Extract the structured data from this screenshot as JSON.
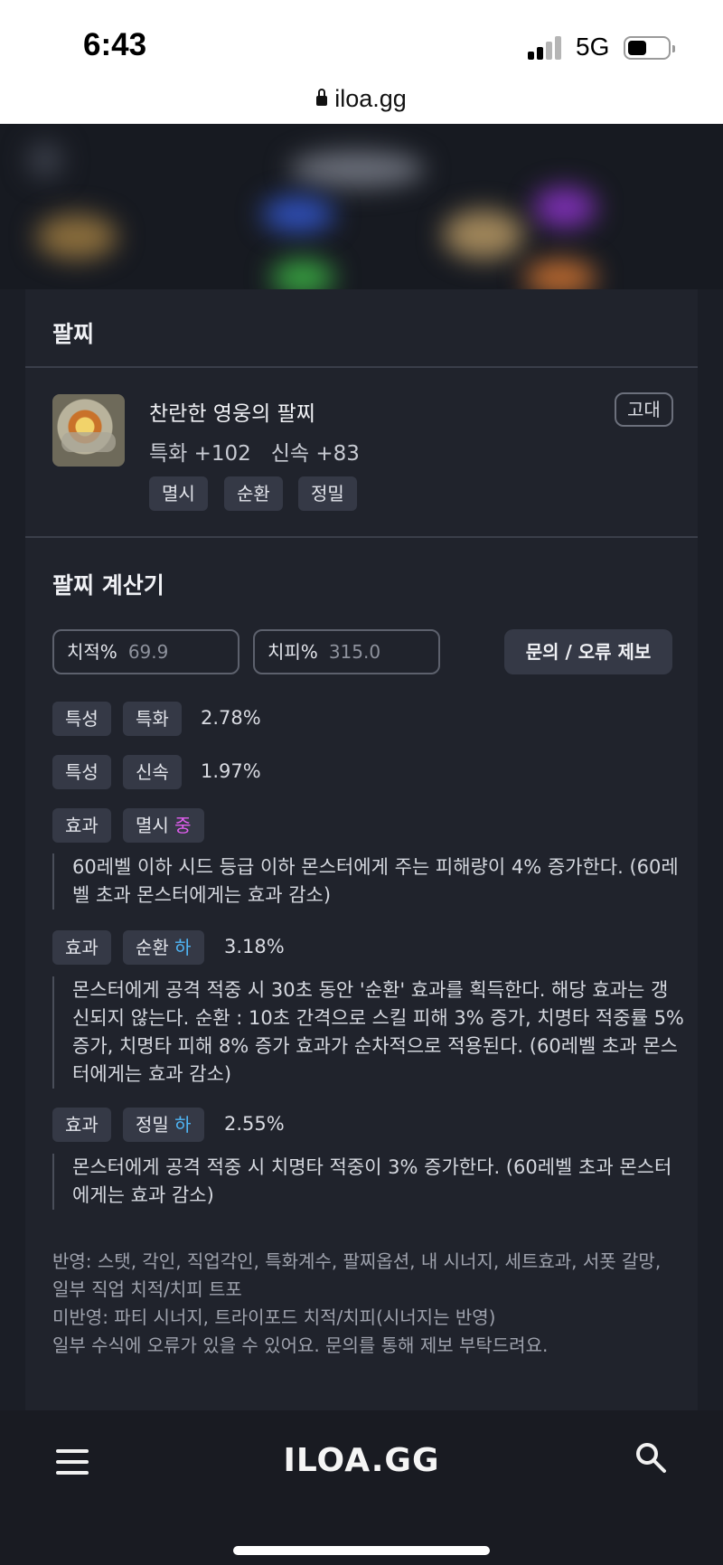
{
  "status_bar": {
    "time": "6:43",
    "network": "5G",
    "url": "iloa.gg"
  },
  "bracelet_section": {
    "title": "팔찌",
    "item_name": "찬란한 영웅의 팔찌",
    "stats": "특화 +102   신속 +83",
    "grade": "고대",
    "tags": [
      "멸시",
      "순환",
      "정밀"
    ]
  },
  "calculator": {
    "title": "팔찌 계산기",
    "crit_rate": {
      "label": "치적%",
      "value": "69.9"
    },
    "crit_damage": {
      "label": "치피%",
      "value": "315.0"
    },
    "report_button": "문의 / 오류 제보",
    "rows": [
      {
        "type": "특성",
        "name": "특화",
        "value": "2.78%"
      },
      {
        "type": "특성",
        "name": "신속",
        "value": "1.97%"
      },
      {
        "type": "효과",
        "name": "멸시",
        "level": "중",
        "value": "",
        "desc": "60레벨 이하 시드 등급 이하 몬스터에게 주는 피해량이 4% 증가한다. (60레벨 초과 몬스터에게는 효과 감소)"
      },
      {
        "type": "효과",
        "name": "순환",
        "level": "하",
        "value": "3.18%",
        "desc": "몬스터에게 공격 적중 시 30초 동안 '순환' 효과를 획득한다. 해당 효과는 갱신되지 않는다. 순환 : 10초 간격으로 스킬 피해 3% 증가, 치명타 적중률 5% 증가, 치명타 피해 8% 증가 효과가 순차적으로 적용된다. (60레벨 초과 몬스터에게는 효과 감소)"
      },
      {
        "type": "효과",
        "name": "정밀",
        "level": "하",
        "value": "2.55%",
        "desc": "몬스터에게 공격 적중 시 치명타 적중이 3% 증가한다. (60레벨 초과 몬스터에게는 효과 감소)"
      }
    ],
    "notes": [
      "반영: 스탯, 각인, 직업각인, 특화계수, 팔찌옵션, 내 시너지, 세트효과, 서폿 갈망, 일부 직업 치적/치피 트포",
      "미반영: 파티 시너지, 트라이포드 치적/치피(시너지는 반영)",
      "일부 수식에 오류가 있을 수 있어요. 문의를 통해 제보 부탁드려요."
    ]
  },
  "bottom_nav": {
    "logo": "ILOA.GG",
    "menu_icon": "hamburger-icon",
    "search_icon": "search-icon"
  },
  "colors": {
    "level_mid": "#e25ef0",
    "level_low": "#4fb6f6",
    "panel_bg": "#20232c"
  }
}
